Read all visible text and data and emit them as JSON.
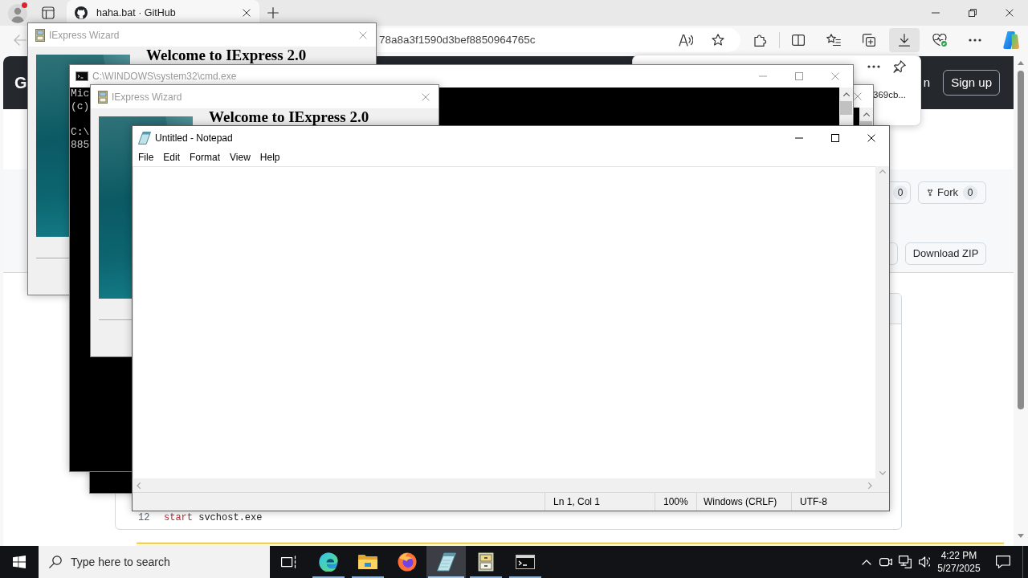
{
  "browser": {
    "tabs": [
      {
        "title": "haha.bat · GitHub",
        "selected": true
      }
    ],
    "address": "78a8a3f1590d3bef8850964765c",
    "downloads_button": {
      "selected": true
    },
    "downloads_panel": {
      "items": [
        {
          "name": "369cb..."
        }
      ]
    },
    "page": {
      "header_title": "G",
      "sign_in": "n",
      "sign_up": "Sign up",
      "star_count": "0",
      "fork": {
        "label": "Fork",
        "count": "0"
      },
      "download_zip": "Download ZIP",
      "code_lines": [
        {
          "number": "12",
          "keyword": "start",
          "text": "svchost.exe"
        }
      ]
    }
  },
  "windows": [
    {
      "kind": "wizard",
      "title": "IExpress Wizard",
      "active": false,
      "heading": "Welcome to IExpress 2.0"
    },
    {
      "kind": "console",
      "active": false
    },
    {
      "kind": "console",
      "title": "C:\\WINDOWS\\system32\\cmd.exe",
      "active": false,
      "paragraphs": [
        [
          "Mic",
          "(c)"
        ],
        [
          "C:\\",
          "885"
        ]
      ]
    },
    {
      "kind": "wizard",
      "title": "IExpress Wizard",
      "active": false,
      "heading": "Welcome to IExpress 2.0"
    },
    {
      "kind": "notepad",
      "title": "Untitled - Notepad",
      "active": true,
      "menu": [
        "File",
        "Edit",
        "Format",
        "View",
        "Help"
      ],
      "status": [
        "Ln 1, Col 1",
        "100%",
        "Windows (CRLF)",
        "UTF-8"
      ]
    }
  ],
  "taskbar": {
    "search": {
      "placeholder": "Type here to search"
    },
    "apps": [
      {
        "kind": "edge",
        "running": true,
        "selected": false
      },
      {
        "kind": "explorer",
        "running": true,
        "selected": false
      },
      {
        "kind": "firefox",
        "running": false,
        "selected": false
      },
      {
        "kind": "notepad",
        "running": true,
        "selected": true
      },
      {
        "kind": "wizard",
        "running": true,
        "selected": false
      },
      {
        "kind": "console",
        "running": true,
        "selected": false
      }
    ],
    "clock": {
      "time": "4:22 PM",
      "date": "5/27/2025"
    }
  }
}
